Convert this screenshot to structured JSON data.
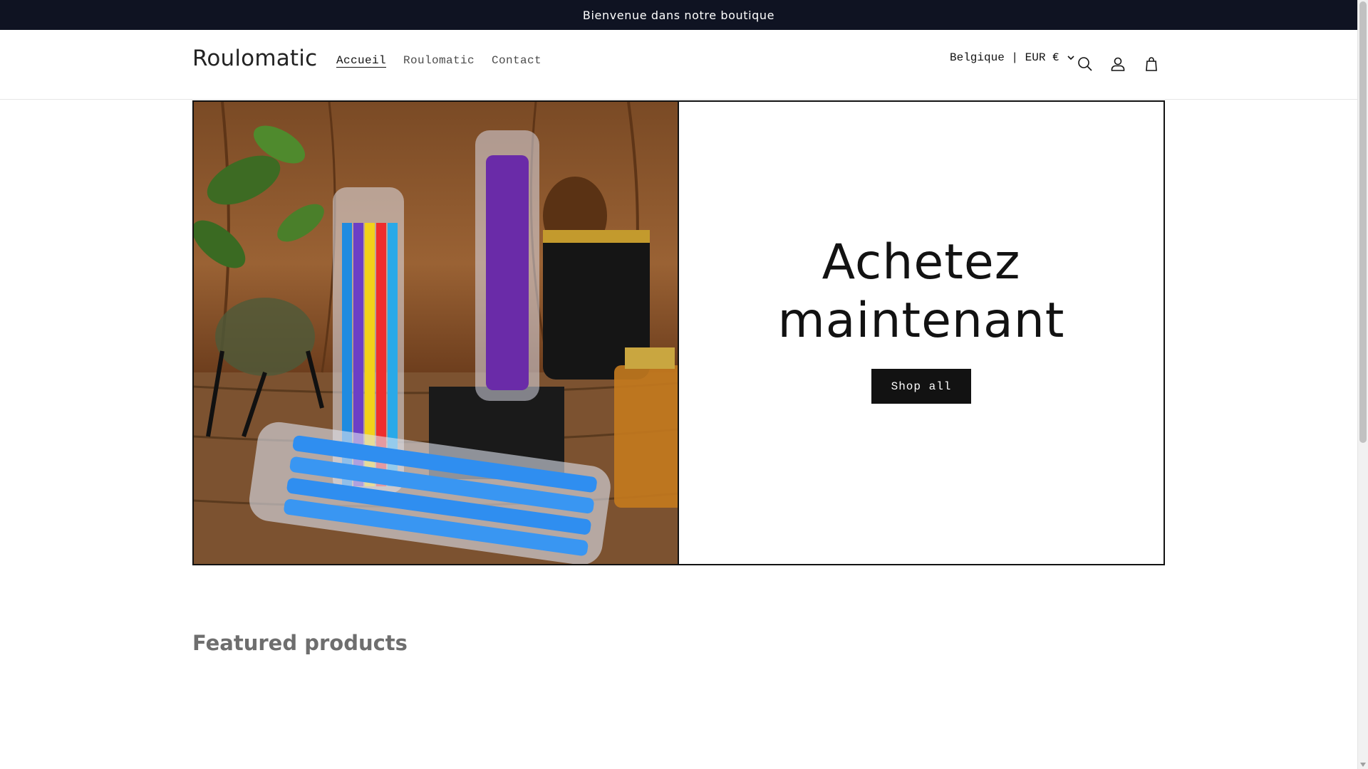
{
  "announcement": {
    "text": "Bienvenue dans notre boutique"
  },
  "header": {
    "logo": "Roulomatic",
    "nav": [
      {
        "label": "Accueil",
        "active": true
      },
      {
        "label": "Roulomatic",
        "active": false
      },
      {
        "label": "Contact",
        "active": false
      }
    ],
    "locale": "Belgique | EUR €",
    "icons": [
      "search-icon",
      "account-icon",
      "cart-icon"
    ]
  },
  "hero": {
    "image_icon": "product-photo",
    "title_line1": "Achetez",
    "title_line2": "maintenant",
    "button_label": "Shop all"
  },
  "featured": {
    "title": "Featured products"
  },
  "colors": {
    "announcement_bg": "#0f1322",
    "text": "#121212",
    "button_bg": "#121212",
    "muted": "#6e6e6e"
  }
}
